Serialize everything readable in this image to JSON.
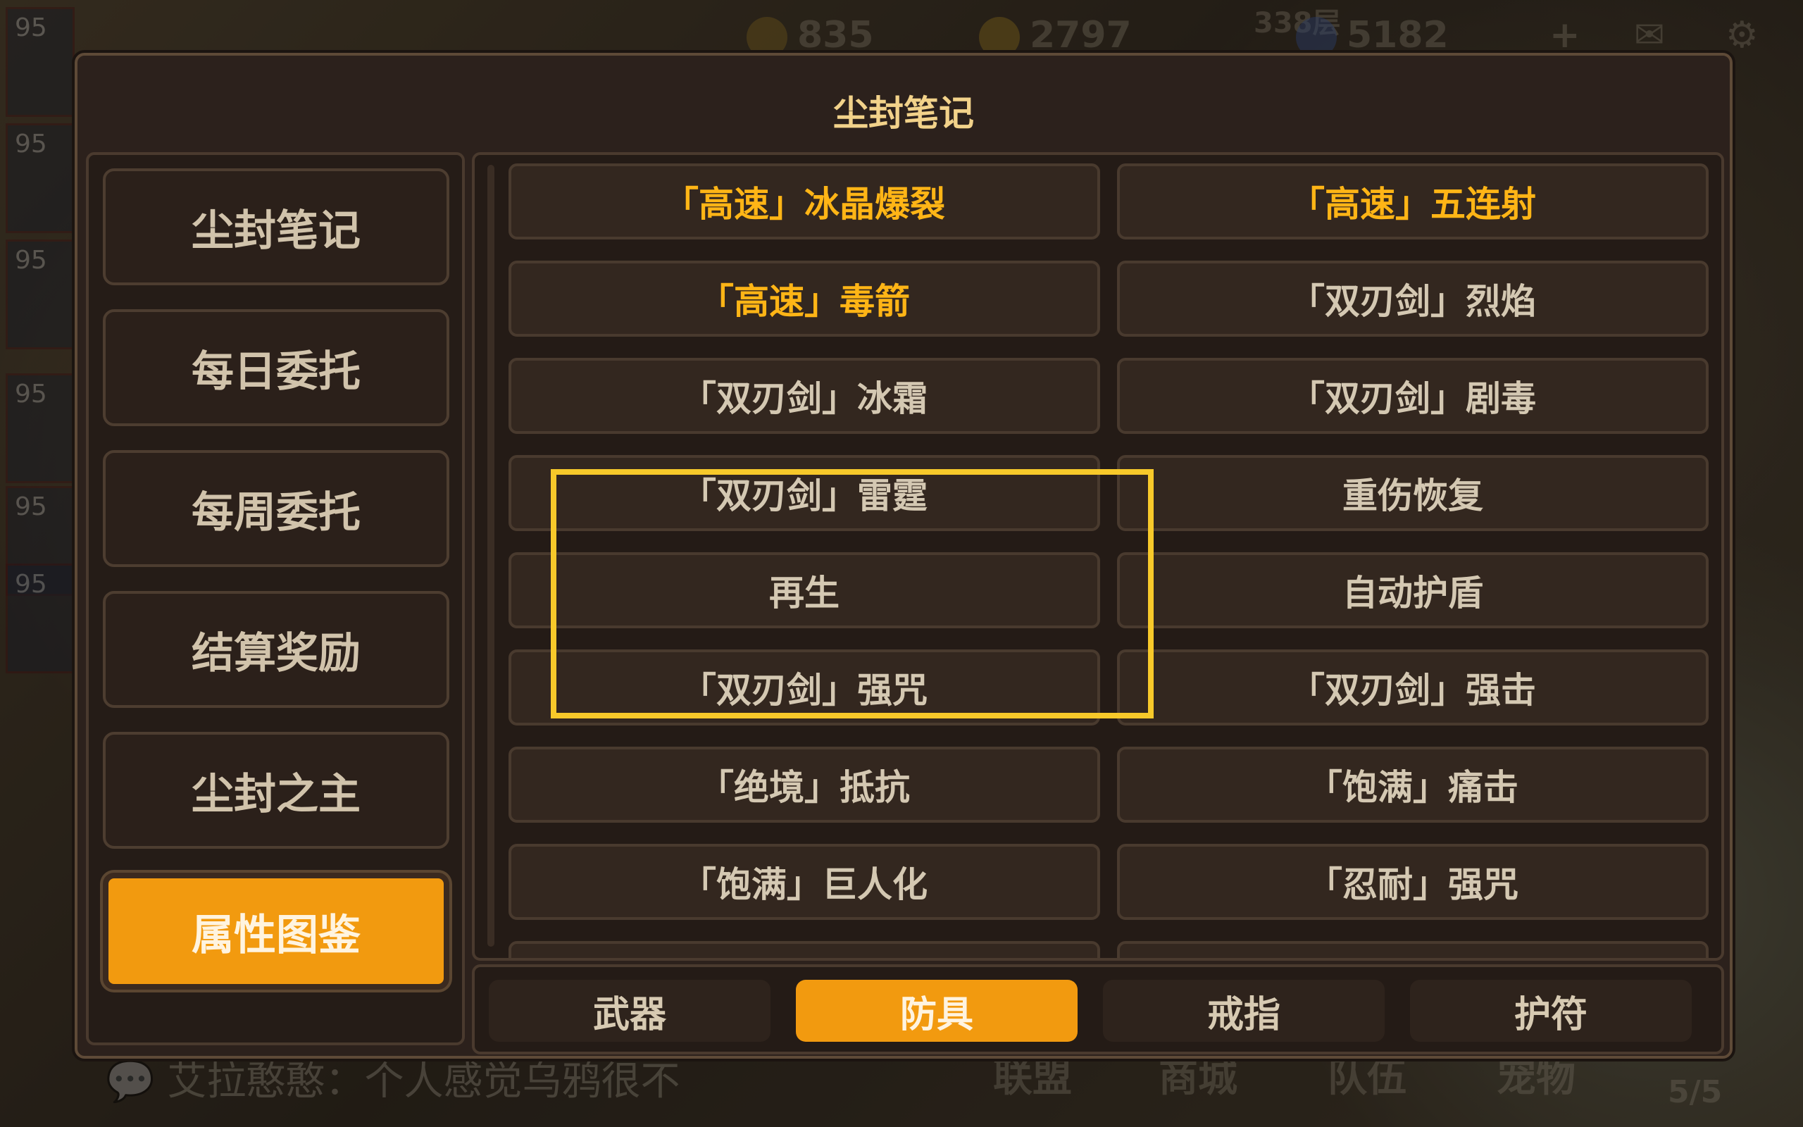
{
  "background": {
    "resources": [
      "835",
      "2797",
      "5182"
    ],
    "floor_label": "338层",
    "hero_levels": [
      "95",
      "95",
      "95",
      "95",
      "95",
      "95"
    ],
    "chat_text": "艾拉憨憨：个人感觉乌鸦很不",
    "bottom_tabs": [
      "联盟",
      "商城",
      "队伍",
      "宠物"
    ],
    "party_count": "5/5"
  },
  "panel": {
    "title": "尘封笔记"
  },
  "nav": {
    "items": [
      {
        "label": "尘封笔记"
      },
      {
        "label": "每日委托"
      },
      {
        "label": "每周委托"
      },
      {
        "label": "结算奖励"
      },
      {
        "label": "尘封之主"
      },
      {
        "label": "属性图鉴"
      }
    ],
    "active_index": 5
  },
  "entries": [
    {
      "label": "「高速」冰晶爆裂",
      "highlight": true
    },
    {
      "label": "「高速」五连射",
      "highlight": true
    },
    {
      "label": "「高速」毒箭",
      "highlight": true
    },
    {
      "label": "「双刃剑」烈焰",
      "highlight": false
    },
    {
      "label": "「双刃剑」冰霜",
      "highlight": false
    },
    {
      "label": "「双刃剑」剧毒",
      "highlight": false
    },
    {
      "label": "「双刃剑」雷霆",
      "highlight": false
    },
    {
      "label": "重伤恢复",
      "highlight": false
    },
    {
      "label": "再生",
      "highlight": false
    },
    {
      "label": "自动护盾",
      "highlight": false
    },
    {
      "label": "「双刃剑」强咒",
      "highlight": false
    },
    {
      "label": "「双刃剑」强击",
      "highlight": false
    },
    {
      "label": "「绝境」抵抗",
      "highlight": false
    },
    {
      "label": "「饱满」痛击",
      "highlight": false
    },
    {
      "label": "「饱满」巨人化",
      "highlight": false
    },
    {
      "label": "「忍耐」强咒",
      "highlight": false
    }
  ],
  "tabs": [
    {
      "label": "武器"
    },
    {
      "label": "防具"
    },
    {
      "label": "戒指"
    },
    {
      "label": "护符"
    }
  ],
  "active_tab": 1,
  "colors": {
    "accent": "#f29a0f",
    "highlight_text": "#ffb516",
    "annotation": "#f7c92a"
  }
}
